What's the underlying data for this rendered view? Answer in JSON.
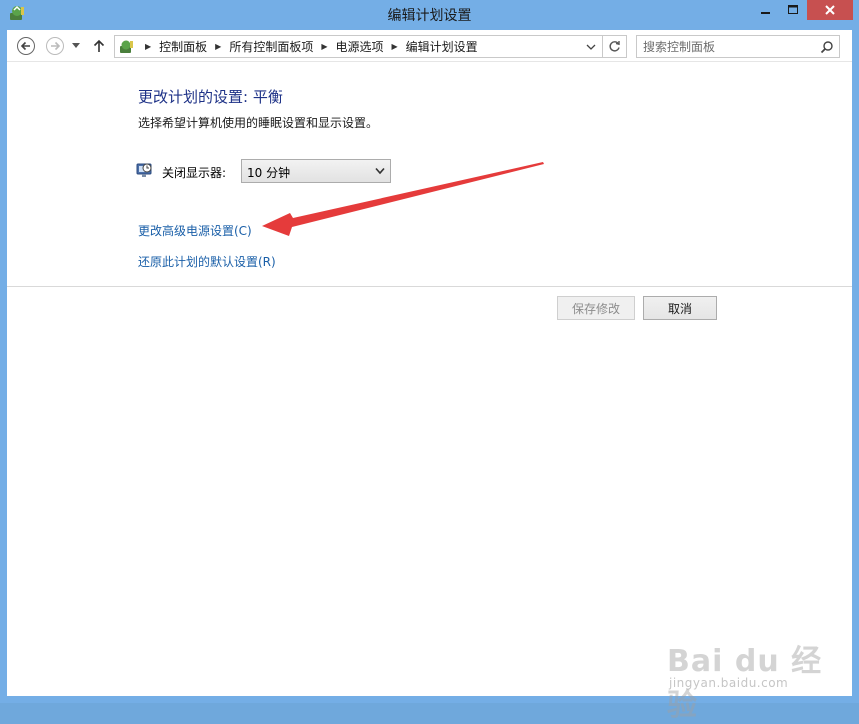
{
  "window": {
    "title": "编辑计划设置",
    "accent": "#74aee6",
    "close_color": "#c75050"
  },
  "nav": {
    "back_icon": "back-arrow-icon",
    "forward_icon": "forward-arrow-icon",
    "up_icon": "up-arrow-icon",
    "breadcrumbs": [
      "控制面板",
      "所有控制面板项",
      "电源选项",
      "编辑计划设置"
    ],
    "search_placeholder": "搜索控制面板"
  },
  "main": {
    "heading": "更改计划的设置: 平衡",
    "subtext": "选择希望计算机使用的睡眠设置和显示设置。",
    "display_label": "关闭显示器:",
    "display_value": "10 分钟",
    "link_advanced": "更改高级电源设置(C)",
    "link_restore": "还原此计划的默认设置(R)",
    "save_label": "保存修改",
    "cancel_label": "取消",
    "link_color": "#1a5fa8",
    "heading_color": "#1e3287"
  },
  "watermark": {
    "logo": "Bai du 经验",
    "url": "jingyan.baidu.com"
  }
}
